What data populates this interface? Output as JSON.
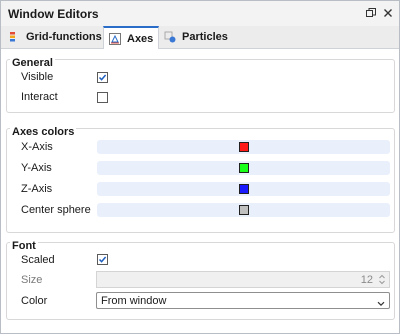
{
  "window": {
    "title": "Window Editors"
  },
  "tabs": [
    {
      "label": "Grid-functions",
      "active": false,
      "icon": "grid-functions-icon"
    },
    {
      "label": "Axes",
      "active": true,
      "icon": "axes-icon"
    },
    {
      "label": "Particles",
      "active": false,
      "icon": "particles-icon"
    }
  ],
  "general": {
    "title": "General",
    "visible_label": "Visible",
    "visible_checked": true,
    "interact_label": "Interact",
    "interact_checked": false
  },
  "axes_colors": {
    "title": "Axes colors",
    "items": [
      {
        "label": "X-Axis",
        "color": "#ff1a1a"
      },
      {
        "label": "Y-Axis",
        "color": "#1aff1a"
      },
      {
        "label": "Z-Axis",
        "color": "#1a1aff"
      },
      {
        "label": "Center sphere",
        "color": "#c0c0c0"
      }
    ]
  },
  "font": {
    "title": "Font",
    "scaled_label": "Scaled",
    "scaled_checked": true,
    "size_label": "Size",
    "size_value": "12",
    "color_label": "Color",
    "color_value": "From window"
  },
  "colors": {
    "accent": "#2a6dc8",
    "color_bar_bg": "#e9f0fb"
  }
}
